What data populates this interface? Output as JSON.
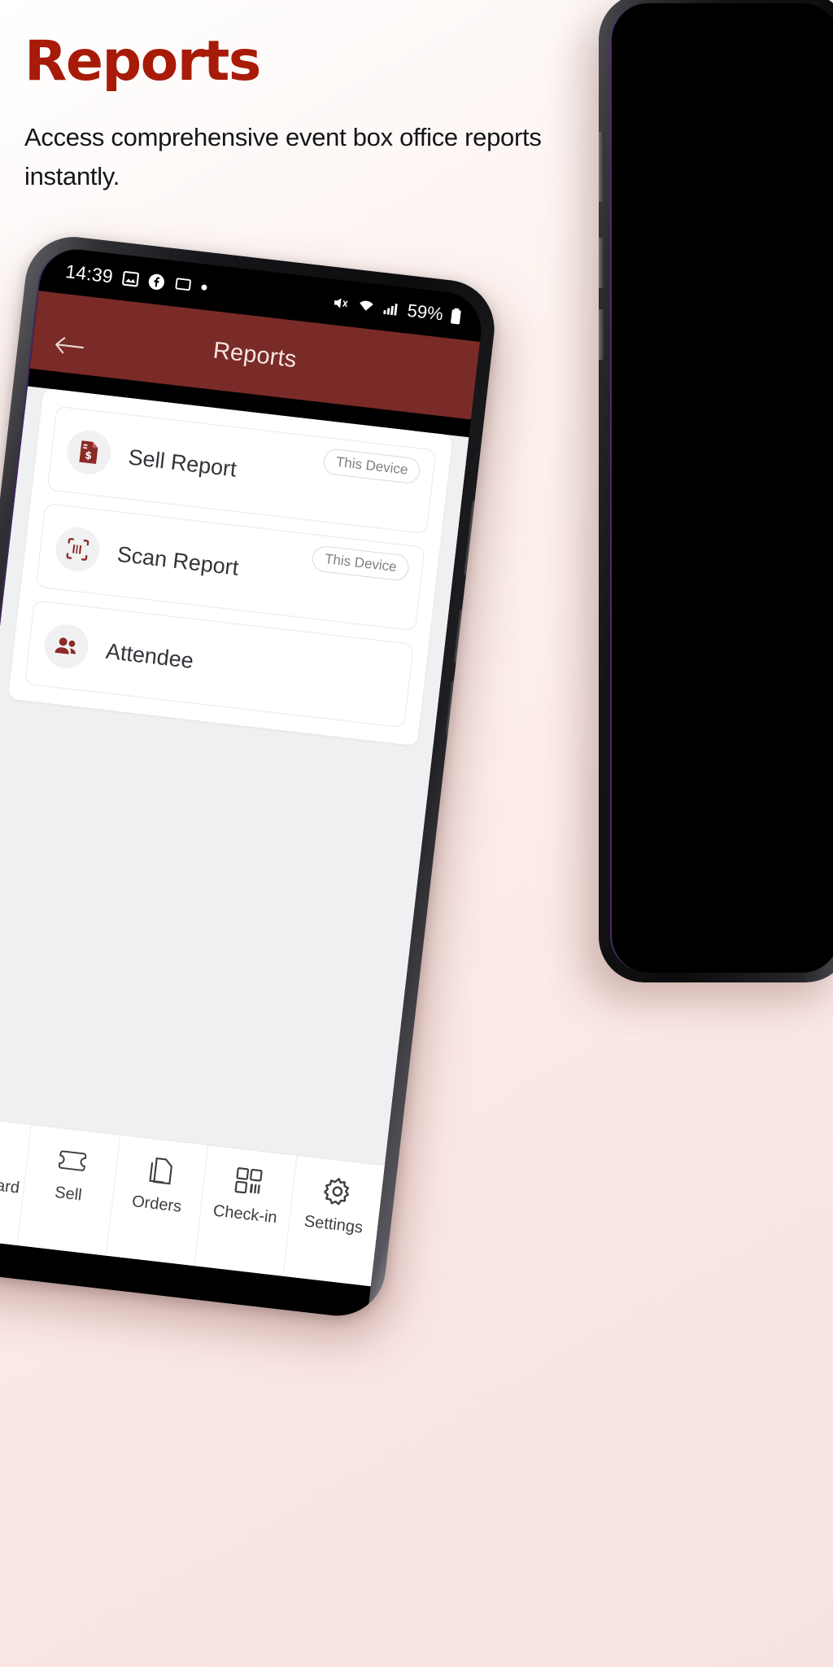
{
  "promo": {
    "title": "Reports",
    "subtitle": "Access comprehensive event box office reports instantly.",
    "title_color": "#a81b09"
  },
  "phone": {
    "status_bar": {
      "time": "14:39",
      "left_icons": [
        "photo-icon",
        "facebook-icon",
        "cast-screen-icon",
        "dot-indicator-icon"
      ],
      "right_icons": [
        "mute-icon",
        "wifi-icon",
        "cellular-signal-icon"
      ],
      "battery_percent": "59%",
      "battery_icon": "battery-icon"
    },
    "app_bar": {
      "title": "Reports",
      "back_icon": "back-arrow-icon",
      "background_color": "#7a2b27"
    },
    "reports": [
      {
        "label": "Sell Report",
        "icon": "sell-report-document-icon",
        "badge": "This Device"
      },
      {
        "label": "Scan Report",
        "icon": "scan-report-barcode-icon",
        "badge": "This Device"
      },
      {
        "label": "Attendee",
        "icon": "attendee-people-icon",
        "badge": ""
      }
    ],
    "bottom_nav": [
      {
        "label": "Dashboard",
        "icon": "globe-icon"
      },
      {
        "label": "Sell",
        "icon": "ticket-icon"
      },
      {
        "label": "Orders",
        "icon": "documents-icon"
      },
      {
        "label": "Check-in",
        "icon": "qr-code-icon"
      },
      {
        "label": "Settings",
        "icon": "gear-icon"
      }
    ]
  }
}
